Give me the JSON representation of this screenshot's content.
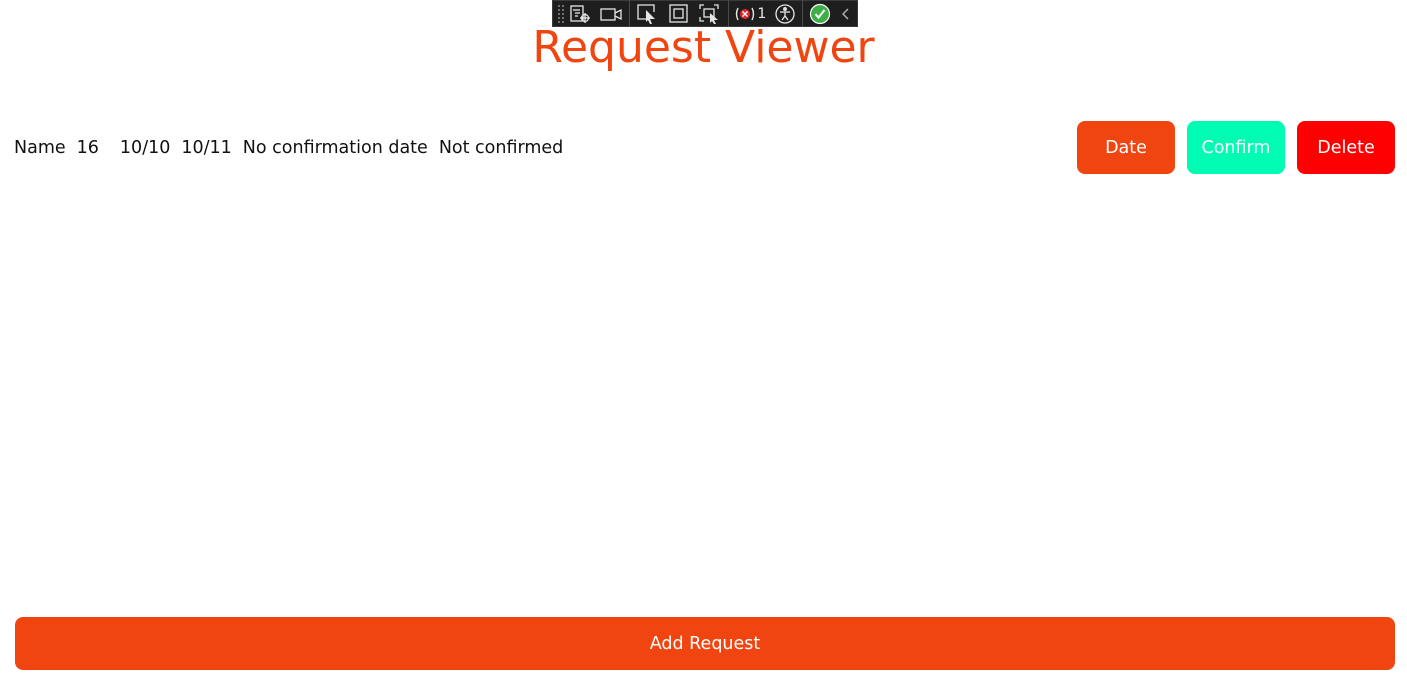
{
  "toolbar": {
    "icons": [
      "live-visual-tree-icon",
      "video-icon",
      "select-element-icon",
      "display-layout-adorners-icon",
      "track-focused-element-icon",
      "binding-failures-icon",
      "accessibility-icon",
      "hot-reload-status-icon",
      "collapse-chevron-icon"
    ],
    "binding_failures_count": "1"
  },
  "title": "Request Viewer",
  "request": {
    "name": "Name",
    "number": "16",
    "start_date": "10/10",
    "end_date": "10/11",
    "confirmation_date": "No confirmation date",
    "status": "Not confirmed",
    "actions": {
      "date_label": "Date",
      "confirm_label": "Confirm",
      "delete_label": "Delete"
    }
  },
  "add_request_label": "Add Request",
  "colors": {
    "accent": "#f04511",
    "confirm": "#00fbb2",
    "delete": "#ff0000",
    "toolbar_bg": "#1e1e1e"
  }
}
